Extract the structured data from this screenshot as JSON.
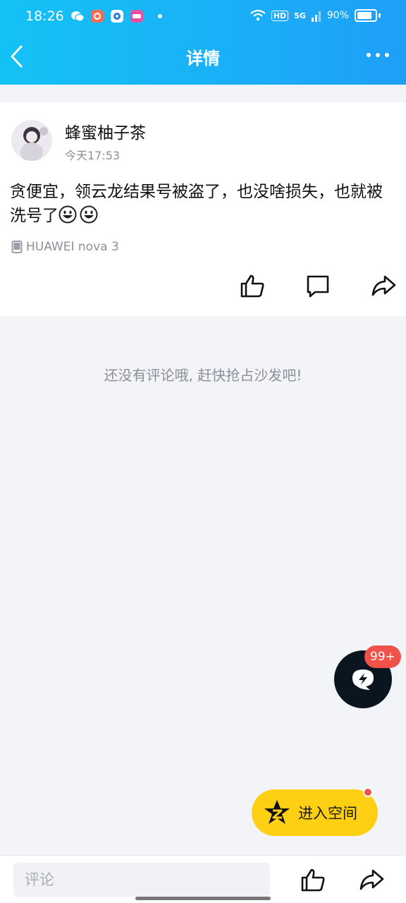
{
  "status_bar": {
    "time": "18:26",
    "network": "5G",
    "hd": "HD",
    "battery": "90%"
  },
  "nav": {
    "title": "详情"
  },
  "post": {
    "username": "蜂蜜柚子茶",
    "timestamp": "今天17:53",
    "text": "贪便宜，领云龙结果号被盗了，也没啥损失，也就被洗号了",
    "device": "HUAWEI nova 3"
  },
  "comments": {
    "empty_message": "还没有评论哦, 赶快抢占沙发吧!"
  },
  "fab": {
    "badge": "99+"
  },
  "space_button": {
    "label": "进入空间"
  },
  "bottom_bar": {
    "placeholder": "评论"
  },
  "colors": {
    "header_gradient_start": "#13c2f5",
    "header_gradient_end": "#1e9ff7",
    "badge_red": "#f0524a",
    "space_yellow": "#ffcf14"
  }
}
